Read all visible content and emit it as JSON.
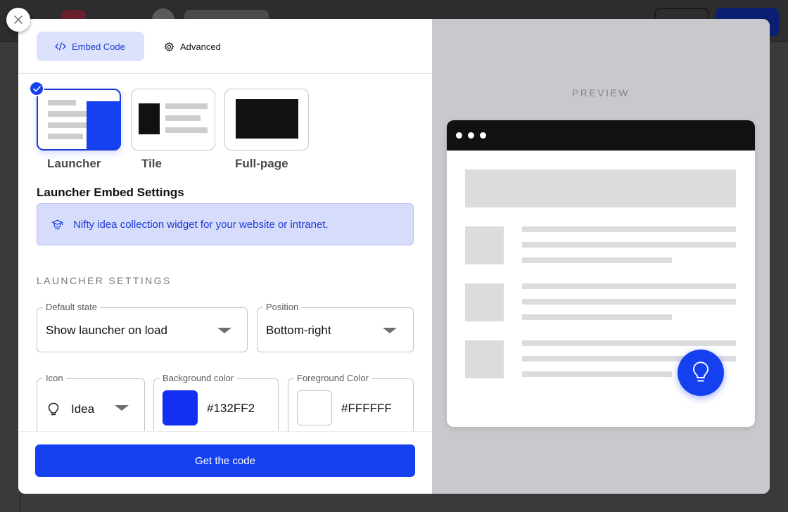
{
  "tabs": [
    {
      "label": "Embed Code",
      "icon": "code-icon",
      "active": true
    },
    {
      "label": "Advanced",
      "icon": "gear-icon",
      "active": false
    }
  ],
  "layouts": [
    {
      "label": "Launcher",
      "selected": true
    },
    {
      "label": "Tile",
      "selected": false
    },
    {
      "label": "Full-page",
      "selected": false
    }
  ],
  "section_title": "Launcher Embed Settings",
  "info_text": "Nifty idea collection widget for your website or intranet.",
  "settings_heading": "LAUNCHER SETTINGS",
  "fields": {
    "default_state": {
      "label": "Default state",
      "value": "Show launcher on load"
    },
    "position": {
      "label": "Position",
      "value": "Bottom-right"
    },
    "icon": {
      "label": "Icon",
      "value": "Idea"
    },
    "background_color": {
      "label": "Background color",
      "value": "#132FF2"
    },
    "foreground_color": {
      "label": "Foreground Color",
      "value": "#FFFFFF"
    }
  },
  "cta_label": "Get the code",
  "preview_label": "PREVIEW",
  "colors": {
    "accent": "#1540f0",
    "accent_light": "#dce2fb",
    "preview_bg": "#c9c9cd"
  }
}
